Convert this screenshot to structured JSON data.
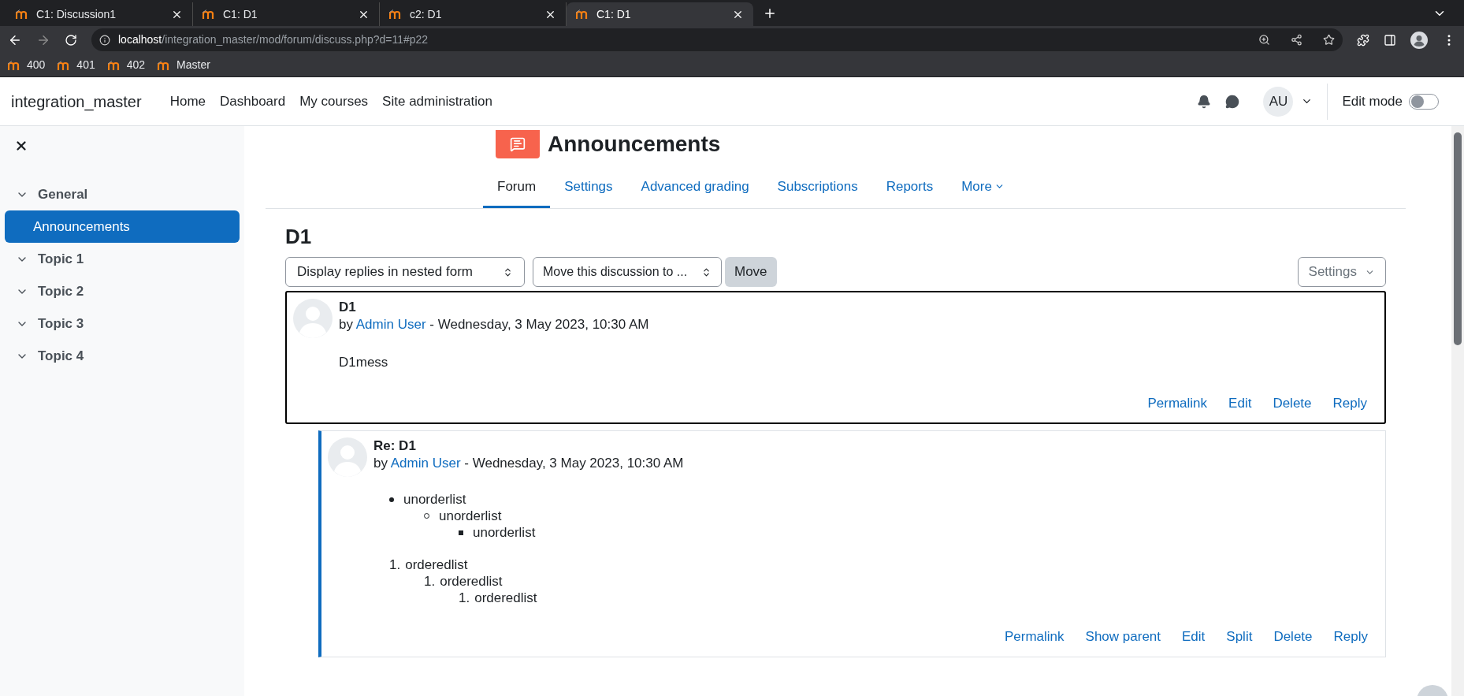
{
  "browser": {
    "tabs": [
      {
        "title": "C1: Discussion1",
        "selected": false
      },
      {
        "title": "C1: D1",
        "selected": false
      },
      {
        "title": "c2: D1",
        "selected": false
      },
      {
        "title": "C1: D1",
        "selected": true
      }
    ],
    "url": {
      "host": "localhost",
      "path": "/integration_master/mod/forum/discuss.php?d=11#p22"
    },
    "bookmarks": [
      "400",
      "401",
      "402",
      "Master"
    ]
  },
  "navbar": {
    "site_name": "integration_master",
    "links": [
      "Home",
      "Dashboard",
      "My courses",
      "Site administration"
    ],
    "avatar": "AU",
    "edit_mode": {
      "label": "Edit mode",
      "on": false
    }
  },
  "sidebar": {
    "items": [
      {
        "label": "General",
        "selected": false,
        "children": [
          {
            "label": "Announcements",
            "selected": true
          }
        ]
      },
      {
        "label": "Topic 1",
        "selected": false
      },
      {
        "label": "Topic 2",
        "selected": false
      },
      {
        "label": "Topic 3",
        "selected": false
      },
      {
        "label": "Topic 4",
        "selected": false
      }
    ]
  },
  "page": {
    "title": "Announcements",
    "tabs": [
      {
        "label": "Forum",
        "selected": true,
        "dropdown": false
      },
      {
        "label": "Settings",
        "selected": false,
        "dropdown": false
      },
      {
        "label": "Advanced grading",
        "selected": false,
        "dropdown": false
      },
      {
        "label": "Subscriptions",
        "selected": false,
        "dropdown": false
      },
      {
        "label": "Reports",
        "selected": false,
        "dropdown": false
      },
      {
        "label": "More",
        "selected": false,
        "dropdown": true
      }
    ]
  },
  "discussion": {
    "title": "D1",
    "display_select": "Display replies in nested form",
    "move_select": "Move this discussion to ...",
    "move_button": "Move",
    "settings_button": "Settings",
    "posts": [
      {
        "subject": "D1",
        "by": "by",
        "author": "Admin User",
        "date": "- Wednesday, 3 May 2023, 10:30 AM",
        "focused": true,
        "nested": false,
        "body": [
          {
            "kind": "paragraph",
            "text": "D1mess"
          }
        ],
        "actions": [
          "Permalink",
          "Edit",
          "Delete",
          "Reply"
        ]
      },
      {
        "subject": "Re: D1",
        "by": "by",
        "author": "Admin User",
        "date": "- Wednesday, 3 May 2023, 10:30 AM",
        "focused": false,
        "nested": true,
        "body": [
          {
            "kind": "unordered",
            "items": [
              {
                "text": "unorderlist",
                "children": [
                  {
                    "text": "unorderlist",
                    "children": [
                      {
                        "text": "unorderlist"
                      }
                    ]
                  }
                ]
              }
            ]
          },
          {
            "kind": "ordered",
            "items": [
              {
                "marker": "1.",
                "text": "orderedlist",
                "children": [
                  {
                    "marker": "1.",
                    "text": "orderedlist",
                    "children": [
                      {
                        "marker": "1.",
                        "text": "orderedlist"
                      }
                    ]
                  }
                ]
              }
            ]
          }
        ],
        "actions": [
          "Permalink",
          "Show parent",
          "Edit",
          "Split",
          "Delete",
          "Reply"
        ]
      }
    ]
  }
}
